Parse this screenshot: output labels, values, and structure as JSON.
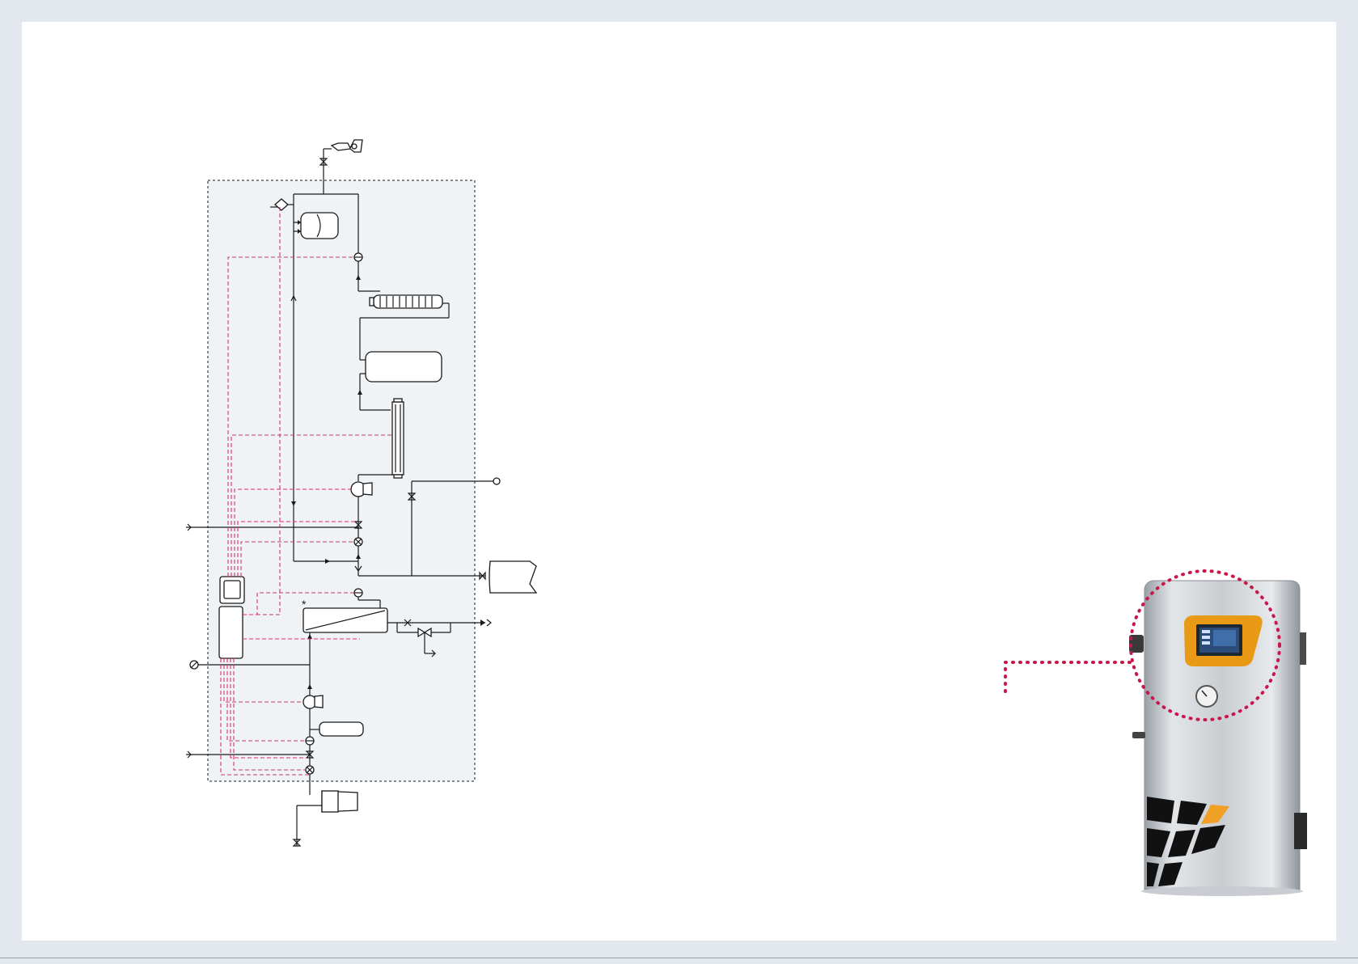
{
  "diagram": {
    "note_marker": "*",
    "colors": {
      "process_line": "#1a1a1a",
      "control_line": "#d6336c",
      "system_boundary_fill": "#f0f3f6",
      "highlight": "#c8174a",
      "display_frame": "#e89a17"
    }
  },
  "product_photo": {
    "icons": [
      "touchscreen-display-icon",
      "pressure-gauge-icon",
      "logo-tiles-icon"
    ]
  }
}
